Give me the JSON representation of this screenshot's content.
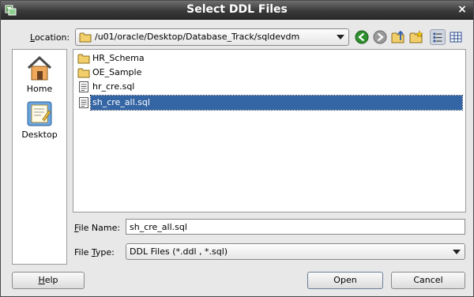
{
  "window": {
    "title": "Select DDL Files",
    "close_glyph": "×"
  },
  "location": {
    "label_mnemonic": "L",
    "label_rest": "ocation:",
    "value": "/u01/oracle/Desktop/Database_Track/sqldevdm",
    "icon": "folder-icon"
  },
  "toolbar": {
    "buttons": [
      "back-icon",
      "forward-icon",
      "up-folder-icon",
      "new-folder-icon",
      "list-view-icon",
      "details-view-icon"
    ]
  },
  "places": [
    {
      "label": "Home",
      "icon": "home-icon"
    },
    {
      "label": "Desktop",
      "icon": "desktop-icon"
    }
  ],
  "files": [
    {
      "name": "HR_Schema",
      "type": "folder"
    },
    {
      "name": "OE_Sample",
      "type": "folder"
    },
    {
      "name": "hr_cre.sql",
      "type": "file"
    },
    {
      "name": "sh_cre_all.sql",
      "type": "file",
      "selected": true
    }
  ],
  "file_name": {
    "label_mnemonic": "F",
    "label_rest": "ile Name:",
    "value": "sh_cre_all.sql"
  },
  "file_type": {
    "label_pre": "File ",
    "label_mnemonic": "T",
    "label_post": "ype:",
    "value": "DDL Files (*.ddl , *.sql)"
  },
  "buttons": {
    "help_mnemonic": "H",
    "help_rest": "elp",
    "open": "Open",
    "cancel": "Cancel"
  },
  "colors": {
    "selection": "#3465a4",
    "titlebar": "#3a3a3a",
    "folder": "#f2cf6a"
  }
}
